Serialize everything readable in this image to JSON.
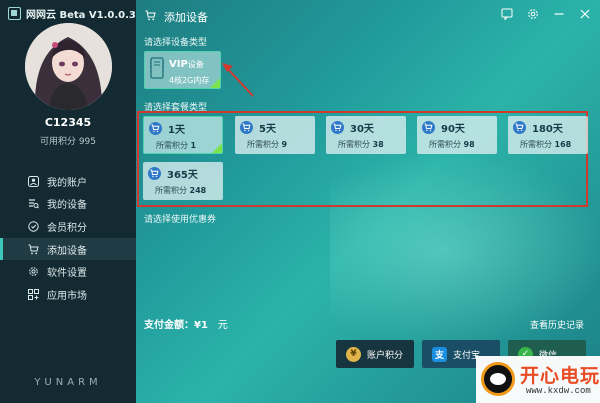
{
  "app": {
    "title": "网网云 Beta V1.0.0.3"
  },
  "user": {
    "name": "C12345",
    "points_label": "可用积分 995"
  },
  "sidebar": {
    "items": [
      {
        "label": "我的账户",
        "icon": "user-icon"
      },
      {
        "label": "我的设备",
        "icon": "device-list-icon"
      },
      {
        "label": "会员积分",
        "icon": "points-icon"
      },
      {
        "label": "添加设备",
        "icon": "cart-icon",
        "active": true
      },
      {
        "label": "软件设置",
        "icon": "gear-icon"
      },
      {
        "label": "应用市场",
        "icon": "app-grid-icon"
      }
    ],
    "brand": "YUNARM"
  },
  "header": {
    "title": "添加设备",
    "buttons": [
      "feedback-icon",
      "gear-icon",
      "minimize-icon",
      "close-icon"
    ]
  },
  "main": {
    "device_type_label": "请选择设备类型",
    "device": {
      "name": "VIP",
      "name_suffix": "设备",
      "spec": "4核2G内存",
      "selected": true
    },
    "package_label": "请选择套餐类型",
    "packages": [
      {
        "name": "1天",
        "price_label": "所需积分",
        "price": "1",
        "selected": true
      },
      {
        "name": "5天",
        "price_label": "所需积分",
        "price": "9"
      },
      {
        "name": "30天",
        "price_label": "所需积分",
        "price": "38"
      },
      {
        "name": "90天",
        "price_label": "所需积分",
        "price": "98"
      },
      {
        "name": "180天",
        "price_label": "所需积分",
        "price": "168"
      },
      {
        "name": "365天",
        "price_label": "所需积分",
        "price": "248"
      }
    ],
    "coupon_label": "请选择使用优惠券",
    "total_label": "支付金额：¥1",
    "total_unit": "元",
    "history_link": "查看历史记录",
    "pay_buttons": [
      {
        "label": "账户积分",
        "icon": "coin-icon"
      },
      {
        "label": "支付宝",
        "icon": "alipay-icon"
      },
      {
        "label": "微信",
        "icon": "wechat-icon"
      }
    ]
  },
  "watermark": {
    "text": "开心电玩",
    "url": "www.kxdw.com"
  },
  "colors": {
    "sidebar_bg": "#132a33",
    "accent": "#3cc7b8",
    "selected_corner": "#7be34c",
    "highlight_frame": "#d03a2d",
    "package_icon": "#2f79c8"
  }
}
